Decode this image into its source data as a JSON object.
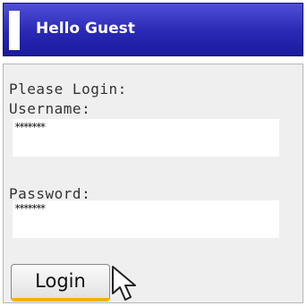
{
  "header": {
    "title": "Hello Guest"
  },
  "login_form": {
    "prompt": "Please Login:",
    "username_label": "Username:",
    "username_value": "*******",
    "password_label": "Password:",
    "password_value": "*******",
    "login_button_label": "Login"
  },
  "colors": {
    "header_blue": "#2828b4",
    "panel_gray": "#efefef",
    "button_accent": "#f2b400"
  },
  "icons": {
    "cursor": "arrow-cursor-icon"
  }
}
